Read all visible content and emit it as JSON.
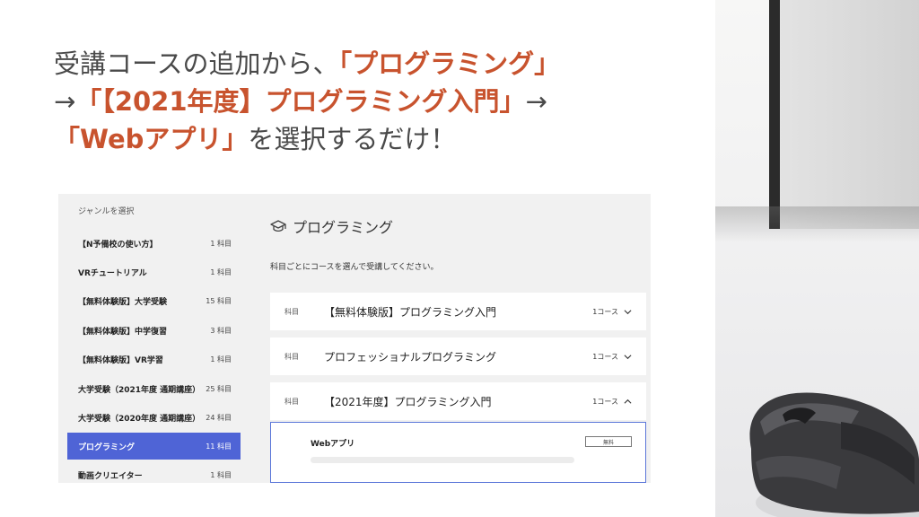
{
  "headline": {
    "line1_prefix": "受講コースの追加から、",
    "line1_highlight": "「プログラミング」",
    "line2_arrow_start": "→",
    "line2_highlight": "「【2021年度】プログラミング入門」",
    "line2_arrow_end": "→",
    "line3_highlight": "「Webアプリ」",
    "line3_suffix": "を選択するだけ！"
  },
  "sidebar": {
    "title": "ジャンルを選択",
    "items": [
      {
        "label": "【N予備校の使い方】",
        "count": "1 科目"
      },
      {
        "label": "VRチュートリアル",
        "count": "1 科目"
      },
      {
        "label": "【無料体験版】大学受験",
        "count": "15 科目"
      },
      {
        "label": "【無料体験版】中学復習",
        "count": "3 科目"
      },
      {
        "label": "【無料体験版】VR学習",
        "count": "1 科目"
      },
      {
        "label": "大学受験（2021年度 通期講座）",
        "count": "25 科目"
      },
      {
        "label": "大学受験（2020年度 通期講座）",
        "count": "24 科目"
      },
      {
        "label": "プログラミング",
        "count": "11 科目",
        "active": true
      },
      {
        "label": "動画クリエイター",
        "count": "1 科目"
      }
    ]
  },
  "main": {
    "title": "プログラミング",
    "title_icon": "graduation-cap-icon",
    "description": "科目ごとにコースを選んで受講してください。",
    "subjects": [
      {
        "tag": "科目",
        "name": "【無料体験版】プログラミング入門",
        "count": "1コース",
        "expanded": false
      },
      {
        "tag": "科目",
        "name": "プロフェッショナルプログラミング",
        "count": "1コース",
        "expanded": false
      },
      {
        "tag": "科目",
        "name": "【2021年度】プログラミング入門",
        "count": "1コース",
        "expanded": true
      }
    ],
    "course": {
      "name": "Webアプリ",
      "badge": "無料"
    }
  },
  "colors": {
    "highlight": "#c8532e",
    "active_item": "#4f64d6",
    "course_border": "#5b76d9"
  }
}
